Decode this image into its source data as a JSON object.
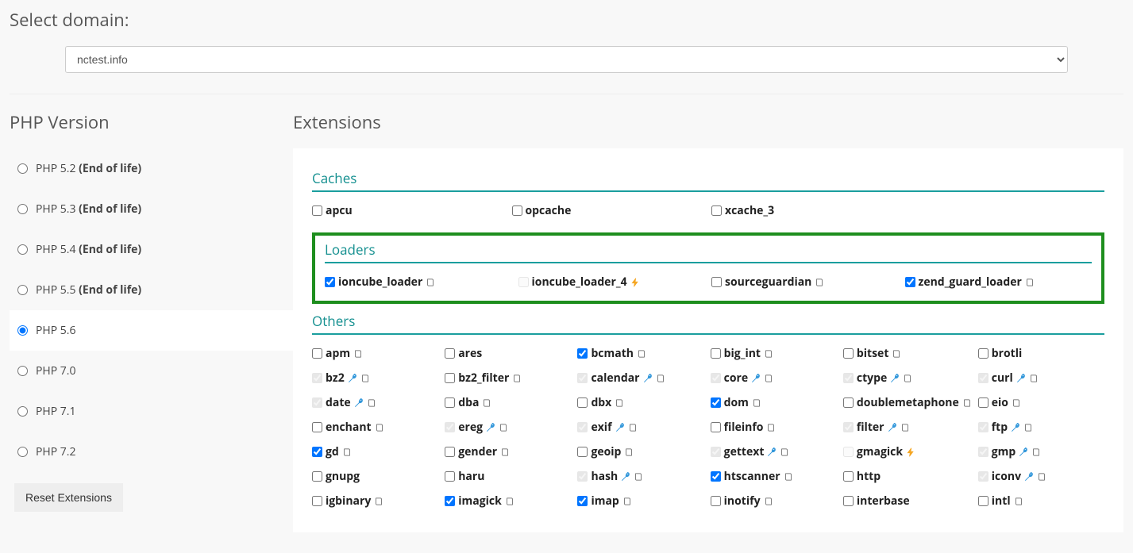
{
  "labels": {
    "select_domain": "Select domain:",
    "php_version": "PHP Version",
    "extensions": "Extensions",
    "reset": "Reset Extensions"
  },
  "domain": {
    "value": "nctest.info"
  },
  "versions": [
    {
      "label": "PHP 5.2",
      "eol": "(End of life)",
      "checked": false
    },
    {
      "label": "PHP 5.3",
      "eol": "(End of life)",
      "checked": false
    },
    {
      "label": "PHP 5.4",
      "eol": "(End of life)",
      "checked": false
    },
    {
      "label": "PHP 5.5",
      "eol": "(End of life)",
      "checked": false
    },
    {
      "label": "PHP 5.6",
      "eol": "",
      "checked": true
    },
    {
      "label": "PHP 7.0",
      "eol": "",
      "checked": false
    },
    {
      "label": "PHP 7.1",
      "eol": "",
      "checked": false
    },
    {
      "label": "PHP 7.2",
      "eol": "",
      "checked": false
    }
  ],
  "categories": [
    {
      "name": "Caches",
      "cols": "four",
      "highlight": false,
      "items": [
        {
          "label": "apcu",
          "checked": false,
          "disabled": false,
          "wrench": false,
          "book": false,
          "bolt": false
        },
        {
          "label": "opcache",
          "checked": false,
          "disabled": false,
          "wrench": false,
          "book": false,
          "bolt": false
        },
        {
          "label": "xcache_3",
          "checked": false,
          "disabled": false,
          "wrench": false,
          "book": false,
          "bolt": false
        }
      ]
    },
    {
      "name": "Loaders",
      "cols": "four",
      "highlight": true,
      "items": [
        {
          "label": "ioncube_loader",
          "checked": true,
          "disabled": false,
          "wrench": false,
          "book": true,
          "bolt": false
        },
        {
          "label": "ioncube_loader_4",
          "checked": false,
          "disabled": true,
          "wrench": false,
          "book": false,
          "bolt": true
        },
        {
          "label": "sourceguardian",
          "checked": false,
          "disabled": false,
          "wrench": false,
          "book": true,
          "bolt": false
        },
        {
          "label": "zend_guard_loader",
          "checked": true,
          "disabled": false,
          "wrench": false,
          "book": true,
          "bolt": false
        }
      ]
    },
    {
      "name": "Others",
      "cols": "six",
      "highlight": false,
      "items": [
        {
          "label": "apm",
          "checked": false,
          "disabled": false,
          "wrench": false,
          "book": true,
          "bolt": false
        },
        {
          "label": "ares",
          "checked": false,
          "disabled": false,
          "wrench": false,
          "book": false,
          "bolt": false
        },
        {
          "label": "bcmath",
          "checked": true,
          "disabled": false,
          "wrench": false,
          "book": true,
          "bolt": false
        },
        {
          "label": "big_int",
          "checked": false,
          "disabled": false,
          "wrench": false,
          "book": true,
          "bolt": false
        },
        {
          "label": "bitset",
          "checked": false,
          "disabled": false,
          "wrench": false,
          "book": true,
          "bolt": false
        },
        {
          "label": "brotli",
          "checked": false,
          "disabled": false,
          "wrench": false,
          "book": false,
          "bolt": false
        },
        {
          "label": "bz2",
          "checked": true,
          "disabled": true,
          "wrench": true,
          "book": true,
          "bolt": false
        },
        {
          "label": "bz2_filter",
          "checked": false,
          "disabled": false,
          "wrench": false,
          "book": true,
          "bolt": false
        },
        {
          "label": "calendar",
          "checked": true,
          "disabled": true,
          "wrench": true,
          "book": true,
          "bolt": false
        },
        {
          "label": "core",
          "checked": true,
          "disabled": true,
          "wrench": true,
          "book": true,
          "bolt": false
        },
        {
          "label": "ctype",
          "checked": true,
          "disabled": true,
          "wrench": true,
          "book": true,
          "bolt": false
        },
        {
          "label": "curl",
          "checked": true,
          "disabled": true,
          "wrench": true,
          "book": true,
          "bolt": false
        },
        {
          "label": "date",
          "checked": true,
          "disabled": true,
          "wrench": true,
          "book": true,
          "bolt": false
        },
        {
          "label": "dba",
          "checked": false,
          "disabled": false,
          "wrench": false,
          "book": true,
          "bolt": false
        },
        {
          "label": "dbx",
          "checked": false,
          "disabled": false,
          "wrench": false,
          "book": true,
          "bolt": false
        },
        {
          "label": "dom",
          "checked": true,
          "disabled": false,
          "wrench": false,
          "book": true,
          "bolt": false
        },
        {
          "label": "doublemetaphone",
          "checked": false,
          "disabled": false,
          "wrench": false,
          "book": true,
          "bolt": false
        },
        {
          "label": "eio",
          "checked": false,
          "disabled": false,
          "wrench": false,
          "book": true,
          "bolt": false
        },
        {
          "label": "enchant",
          "checked": false,
          "disabled": false,
          "wrench": false,
          "book": true,
          "bolt": false
        },
        {
          "label": "ereg",
          "checked": true,
          "disabled": true,
          "wrench": true,
          "book": true,
          "bolt": false
        },
        {
          "label": "exif",
          "checked": true,
          "disabled": true,
          "wrench": true,
          "book": true,
          "bolt": false
        },
        {
          "label": "fileinfo",
          "checked": false,
          "disabled": false,
          "wrench": false,
          "book": true,
          "bolt": false
        },
        {
          "label": "filter",
          "checked": true,
          "disabled": true,
          "wrench": true,
          "book": true,
          "bolt": false
        },
        {
          "label": "ftp",
          "checked": true,
          "disabled": true,
          "wrench": true,
          "book": true,
          "bolt": false
        },
        {
          "label": "gd",
          "checked": true,
          "disabled": false,
          "wrench": false,
          "book": true,
          "bolt": false
        },
        {
          "label": "gender",
          "checked": false,
          "disabled": false,
          "wrench": false,
          "book": true,
          "bolt": false
        },
        {
          "label": "geoip",
          "checked": false,
          "disabled": false,
          "wrench": false,
          "book": true,
          "bolt": false
        },
        {
          "label": "gettext",
          "checked": true,
          "disabled": true,
          "wrench": true,
          "book": true,
          "bolt": false
        },
        {
          "label": "gmagick",
          "checked": false,
          "disabled": true,
          "wrench": false,
          "book": false,
          "bolt": true
        },
        {
          "label": "gmp",
          "checked": true,
          "disabled": true,
          "wrench": true,
          "book": true,
          "bolt": false
        },
        {
          "label": "gnupg",
          "checked": false,
          "disabled": false,
          "wrench": false,
          "book": false,
          "bolt": false
        },
        {
          "label": "haru",
          "checked": false,
          "disabled": false,
          "wrench": false,
          "book": false,
          "bolt": false
        },
        {
          "label": "hash",
          "checked": true,
          "disabled": true,
          "wrench": true,
          "book": true,
          "bolt": false
        },
        {
          "label": "htscanner",
          "checked": true,
          "disabled": false,
          "wrench": false,
          "book": true,
          "bolt": false
        },
        {
          "label": "http",
          "checked": false,
          "disabled": false,
          "wrench": false,
          "book": false,
          "bolt": false
        },
        {
          "label": "iconv",
          "checked": true,
          "disabled": true,
          "wrench": true,
          "book": true,
          "bolt": false
        },
        {
          "label": "igbinary",
          "checked": false,
          "disabled": false,
          "wrench": false,
          "book": true,
          "bolt": false
        },
        {
          "label": "imagick",
          "checked": true,
          "disabled": false,
          "wrench": false,
          "book": true,
          "bolt": false
        },
        {
          "label": "imap",
          "checked": true,
          "disabled": false,
          "wrench": false,
          "book": true,
          "bolt": false
        },
        {
          "label": "inotify",
          "checked": false,
          "disabled": false,
          "wrench": false,
          "book": true,
          "bolt": false
        },
        {
          "label": "interbase",
          "checked": false,
          "disabled": false,
          "wrench": false,
          "book": false,
          "bolt": false
        },
        {
          "label": "intl",
          "checked": false,
          "disabled": false,
          "wrench": false,
          "book": true,
          "bolt": false
        }
      ]
    }
  ]
}
